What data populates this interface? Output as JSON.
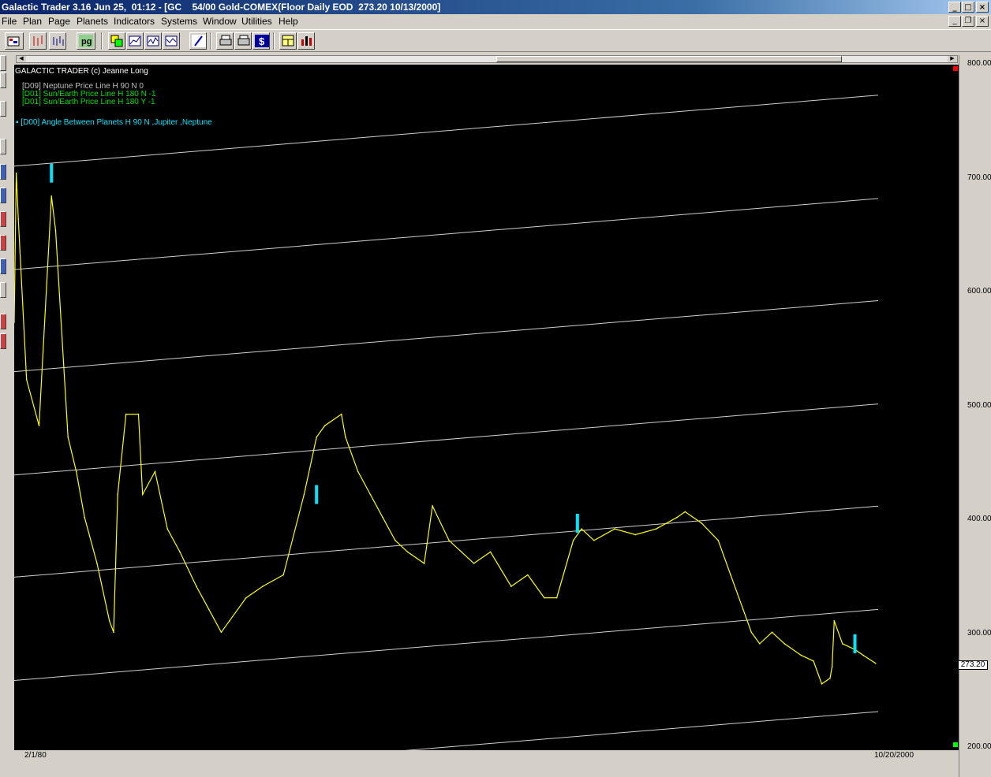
{
  "window": {
    "title": "Galactic Trader 3.16 Jun 25,  01:12 - [GC    54/00 Gold-COMEX(Floor Daily EOD  273.20 10/13/2000]"
  },
  "menu": [
    "File",
    "Plan",
    "Page",
    "Planets",
    "Indicators",
    "Systems",
    "Window",
    "Utilities",
    "Help"
  ],
  "toolbar": {
    "buttons": [
      "open-icon",
      "candlestick-icon",
      "bars-icon",
      "candle-mode-icon",
      "pg-icon",
      "copy-icon",
      "zoom-icon",
      "chart-zoom-icon",
      "draw-icon",
      "print-icon",
      "dollar-icon",
      "layout-icon",
      "bar-chart-icon"
    ],
    "pg_label": "pg",
    "dollar_label": "$"
  },
  "chart_header": {
    "copyright": "GALACTIC TRADER (c) Jeanne Long",
    "legend": [
      {
        "text": "[D09] Neptune Price Line H 90 N 0",
        "color": "#c0c0c0"
      },
      {
        "text": "[D01] Sun/Earth Price Line H 180 N -1",
        "color": "#00e000"
      },
      {
        "text": "[D01] Sun/Earth Price Line H 180 Y -1",
        "color": "#00e000"
      },
      {
        "text": "[D00] Angle Between Planets H 90 N ,Jupiter ,Neptune",
        "color": "#00e5ff"
      }
    ]
  },
  "y_axis": {
    "ticks": [
      "800.00",
      "700.00",
      "600.00",
      "500.00",
      "400.00",
      "300.00",
      "200.00"
    ],
    "current_price": "273.20"
  },
  "x_axis": {
    "first_label": "2/1/80",
    "last_label": "10/20/2000"
  },
  "chart_data": {
    "type": "line",
    "series": [
      {
        "color": "#ffff00",
        "x": [
          1980.0,
          1980.05,
          1980.1,
          1980.3,
          1980.6,
          1980.9,
          1981.0,
          1981.3,
          1981.5,
          1981.7,
          1982.0,
          1982.3,
          1982.4,
          1982.5,
          1982.7,
          1983.0,
          1983.1,
          1983.4,
          1983.7,
          1984.0,
          1984.4,
          1984.7,
          1985.0,
          1985.2,
          1985.6,
          1986.0,
          1986.5,
          1987.0,
          1987.3,
          1987.5,
          1987.9,
          1988.0,
          1988.3,
          1988.6,
          1988.9,
          1989.2,
          1989.5,
          1989.9,
          1990.1,
          1990.5,
          1990.8,
          1991.1,
          1991.5,
          1992.0,
          1992.4,
          1992.8,
          1993.1,
          1993.5,
          1993.7,
          1994.0,
          1994.5,
          1995.0,
          1995.5,
          1996.0,
          1996.2,
          1996.6,
          1997.0,
          1997.3,
          1997.6,
          1997.8,
          1998.0,
          1998.3,
          1998.6,
          1999.0,
          1999.3,
          1999.5,
          1999.7,
          1999.75,
          1999.8,
          2000.0,
          2000.3,
          2000.5,
          2000.8
        ],
        "y": [
          570,
          700,
          660,
          520,
          480,
          680,
          650,
          470,
          440,
          400,
          360,
          310,
          300,
          420,
          490,
          490,
          420,
          440,
          390,
          370,
          340,
          320,
          300,
          310,
          330,
          340,
          350,
          420,
          470,
          480,
          490,
          470,
          440,
          420,
          400,
          380,
          370,
          360,
          410,
          380,
          370,
          360,
          370,
          340,
          350,
          330,
          330,
          380,
          390,
          380,
          390,
          385,
          390,
          400,
          405,
          395,
          380,
          350,
          320,
          300,
          290,
          300,
          290,
          280,
          275,
          255,
          260,
          270,
          310,
          290,
          285,
          280,
          273
        ]
      }
    ],
    "price_lines": "8 parallel Neptune price lines, slope rising left to right",
    "ylim": [
      200,
      800
    ],
    "xlim": [
      1980,
      2000.9
    ]
  }
}
